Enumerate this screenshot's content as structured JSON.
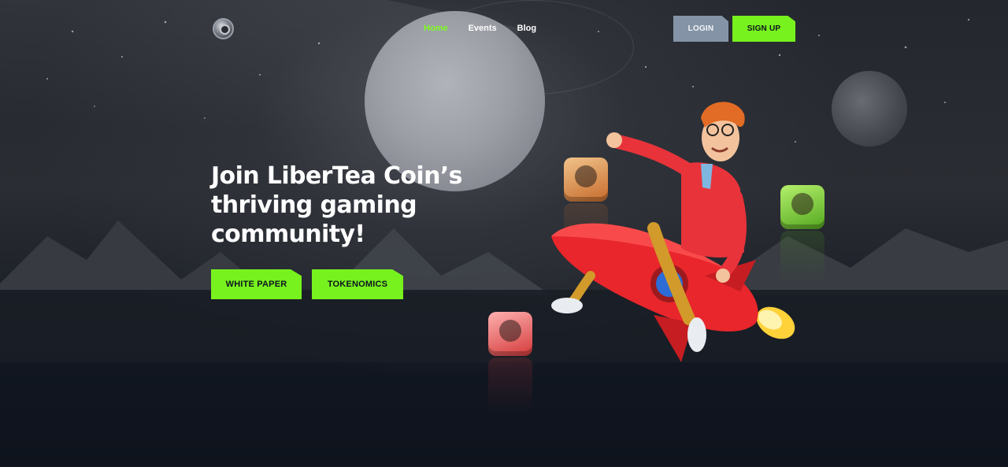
{
  "nav": {
    "links": [
      {
        "label": "Home",
        "active": true
      },
      {
        "label": "Events",
        "active": false
      },
      {
        "label": "Blog",
        "active": false
      }
    ],
    "login_label": "LOGIN",
    "signup_label": "SIGN UP",
    "logo_icon": "coin-logo-icon"
  },
  "hero": {
    "title_line1": "Join LiberTea Coin’s",
    "title_line2": "thriving gaming",
    "title_line3": "community!",
    "white_paper_label": "WHITE PAPER",
    "tokenomics_label": "TOKENOMICS"
  },
  "colors": {
    "accent": "#77f21e",
    "active_link": "#7dfc1e",
    "login_button": "#8494a6",
    "background": "#0f141d"
  }
}
